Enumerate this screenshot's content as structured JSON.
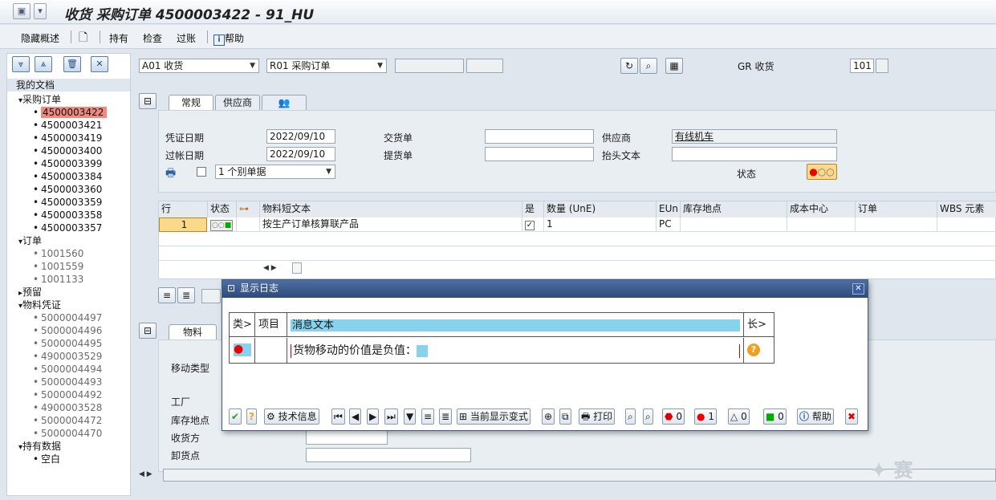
{
  "window": {
    "title": "收货 采购订单 4500003422 - 91_HU"
  },
  "toolbar": {
    "hide_overview": "隐藏概述",
    "hold": "持有",
    "check": "检查",
    "post": "过账",
    "help": "帮助"
  },
  "nav": {
    "my_documents": "我的文档",
    "groups": [
      {
        "label": "采购订单",
        "expanded": true,
        "items": [
          "4500003422",
          "4500003421",
          "4500003419",
          "4500003400",
          "4500003399",
          "4500003384",
          "4500003360",
          "4500003359",
          "4500003358",
          "4500003357"
        ]
      },
      {
        "label": "订单",
        "expanded": true,
        "items": [
          "1001560",
          "1001559",
          "1001133"
        ]
      },
      {
        "label": "预留",
        "expanded": false,
        "items": []
      },
      {
        "label": "物料凭证",
        "expanded": true,
        "items": [
          "5000004497",
          "5000004496",
          "5000004495",
          "4900003529",
          "5000004494",
          "5000004493",
          "5000004492",
          "4900003528",
          "5000004472",
          "5000004470"
        ]
      },
      {
        "label": "持有数据",
        "expanded": true,
        "items": [
          "空白"
        ]
      }
    ],
    "selected_item": "4500003422"
  },
  "header": {
    "transaction": "A01 收货",
    "reference": "R01 采购订单",
    "gr_label": "GR 收货",
    "gr_value": "101"
  },
  "tabs_top": [
    "常规",
    "供应商"
  ],
  "general": {
    "doc_date_label": "凭证日期",
    "doc_date": "2022/09/10",
    "post_date_label": "过帐日期",
    "post_date": "2022/09/10",
    "delivery_note_label": "交货单",
    "bill_of_lading_label": "提货单",
    "vendor_label": "供应商",
    "vendor_value": "有线机车",
    "header_text_label": "抬头文本",
    "status_label": "状态",
    "slip_option": "1 个别单据"
  },
  "items_table": {
    "columns": [
      "行",
      "状态",
      "",
      "物料短文本",
      "是",
      "数量 (UnE)",
      "EUn",
      "库存地点",
      "成本中心",
      "订单",
      "WBS 元素"
    ],
    "rows": [
      {
        "line": "1",
        "text": "按生产订单核算联产品",
        "ok": "✓",
        "qty": "1",
        "eun": "PC"
      }
    ]
  },
  "detail": {
    "tab": "物料",
    "labels": [
      "移动类型",
      "工厂",
      "库存地点",
      "收货方",
      "卸货点"
    ]
  },
  "dialog": {
    "title": "显示日志",
    "col_type": "类>",
    "col_item": "项目",
    "col_text": "消息文本",
    "col_long": "长>",
    "message": "货物移动的价值是负值：",
    "buttons": {
      "tech_info": "技术信息",
      "current_layout": "当前显示变式",
      "print": "打印",
      "stop_count": "0",
      "error_count": "1",
      "warning_count": "0",
      "success_count": "0",
      "help": "帮助"
    }
  },
  "colors": {
    "selected_bg": "#f08a80",
    "dialog_title": "#2d4b7a",
    "accent_text": "#87d3ee"
  }
}
